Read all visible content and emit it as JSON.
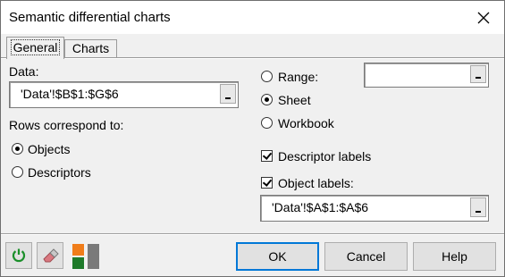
{
  "window": {
    "title": "Semantic differential charts"
  },
  "tabs": [
    {
      "label": "General"
    },
    {
      "label": "Charts"
    }
  ],
  "general": {
    "data_label": "Data:",
    "data_value": "'Data'!$B$1:$G$6",
    "rows_label": "Rows correspond to:",
    "rows_options": [
      {
        "label": "Objects",
        "selected": true
      },
      {
        "label": "Descriptors",
        "selected": false
      }
    ],
    "output_options": [
      {
        "label": "Range:",
        "selected": false
      },
      {
        "label": "Sheet",
        "selected": true
      },
      {
        "label": "Workbook",
        "selected": false
      }
    ],
    "range_value": "",
    "descriptor_labels": {
      "label": "Descriptor labels",
      "checked": true
    },
    "object_labels": {
      "label": "Object labels:",
      "checked": true
    },
    "object_labels_value": "'Data'!$A$1:$A$6"
  },
  "footer": {
    "ok_label": "OK",
    "cancel_label": "Cancel",
    "help_label": "Help",
    "icons": [
      "reset-icon",
      "eraser-icon",
      "layout-icon"
    ]
  },
  "colors": {
    "accent": "#0078d7",
    "reset_green": "#1a8f2a",
    "orange": "#f07d1a",
    "dark_green": "#1e7a2a",
    "gray": "#7a7a7a"
  }
}
